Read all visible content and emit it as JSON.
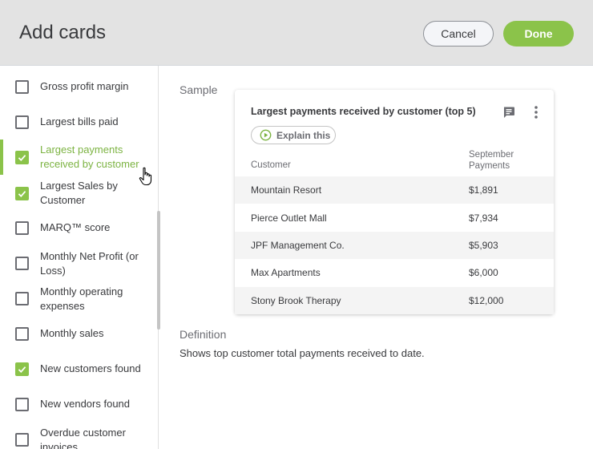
{
  "header": {
    "title": "Add cards",
    "cancel_label": "Cancel",
    "done_label": "Done"
  },
  "sidebar": {
    "items": [
      {
        "label": "Gross profit margin",
        "checked": false
      },
      {
        "label": "Largest bills paid",
        "checked": false
      },
      {
        "label": "Largest payments received by customer",
        "checked": true,
        "selected": true
      },
      {
        "label": "Largest Sales by Customer",
        "checked": true
      },
      {
        "label": "MARQ™ score",
        "checked": false
      },
      {
        "label": "Monthly Net Profit (or Loss)",
        "checked": false
      },
      {
        "label": "Monthly operating expenses",
        "checked": false
      },
      {
        "label": "Monthly sales",
        "checked": false
      },
      {
        "label": "New customers found",
        "checked": true
      },
      {
        "label": "New vendors found",
        "checked": false
      },
      {
        "label": "Overdue customer invoices",
        "checked": false
      }
    ]
  },
  "main": {
    "sample_label": "Sample",
    "card": {
      "title": "Largest payments received by customer (top 5)",
      "explain_label": "Explain this",
      "col_customer": "Customer",
      "col_payments": "September Payments",
      "rows": [
        {
          "customer": "Mountain Resort",
          "amount": "$1,891"
        },
        {
          "customer": "Pierce Outlet Mall",
          "amount": "$7,934"
        },
        {
          "customer": "JPF Management Co.",
          "amount": "$5,903"
        },
        {
          "customer": "Max Apartments",
          "amount": "$6,000"
        },
        {
          "customer": "Stony Brook Therapy",
          "amount": "$12,000"
        }
      ]
    },
    "definition_label": "Definition",
    "definition_text": "Shows top customer total payments received to date."
  },
  "colors": {
    "accent": "#8bc34a",
    "header_bg": "#e3e3e3"
  },
  "icons": {
    "check": "check-icon",
    "explain": "play-circle-icon",
    "comment": "comment-icon",
    "more": "more-vertical-icon",
    "cursor": "hand-pointer-icon"
  }
}
